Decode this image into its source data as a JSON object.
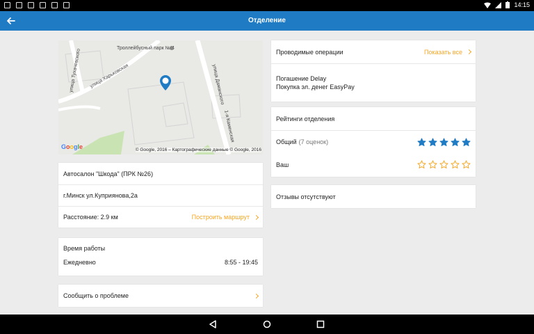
{
  "status_bar": {
    "time": "14:15"
  },
  "app_bar": {
    "title": "Отделение"
  },
  "map": {
    "labels": {
      "park": "Троллейбусный парк № 4",
      "street1": "улица Тухачевского",
      "street2": "улица Харьковская",
      "street3": "улица Даманского",
      "street4": "1-я Каменская"
    },
    "google": "Google",
    "copyright": "© Google, 2016 – Картографические данные © Google, 2016"
  },
  "branch": {
    "name": "Автосалон \"Шкода\" (ПРК №26)",
    "address": "г.Минск ул.Куприянова,2а",
    "distance": "Расстояние: 2.9 км",
    "route_link": "Построить маршрут"
  },
  "hours": {
    "title": "Время работы",
    "day": "Ежедневно",
    "time": "8:55 - 19:45"
  },
  "report": {
    "label": "Сообщить о проблеме"
  },
  "operations": {
    "title": "Проводимые операции",
    "show_all": "Показать все",
    "items": [
      "Погашение Delay",
      "Покупка эл. денег EasyPay"
    ]
  },
  "ratings": {
    "title": "Рейтинги отделения",
    "overall_label": "Общий",
    "overall_count": "(7 оценок)",
    "overall_value": 5,
    "yours_label": "Ваш",
    "yours_value": 0,
    "max": 5,
    "filled_color": "#1e7bc4",
    "empty_color": "#f5a623"
  },
  "reviews": {
    "empty": "Отзывы отсутствуют"
  },
  "colors": {
    "accent": "#1e7bc4",
    "link": "#f5a623"
  }
}
